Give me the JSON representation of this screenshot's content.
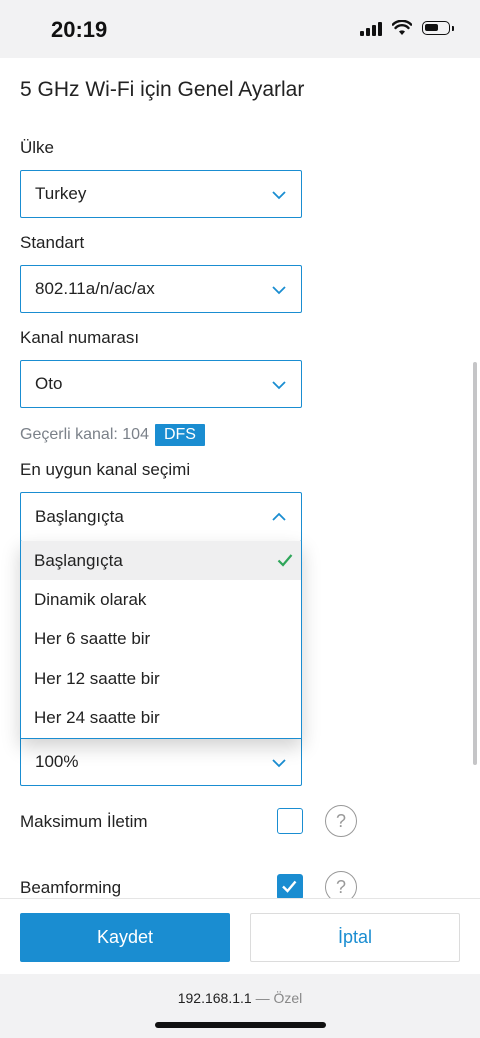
{
  "status_bar": {
    "time": "20:19"
  },
  "page": {
    "title": "5 GHz Wi-Fi için Genel Ayarlar"
  },
  "fields": {
    "country": {
      "label": "Ülke",
      "value": "Turkey"
    },
    "standard": {
      "label": "Standart",
      "value": "802.11a/n/ac/ax"
    },
    "channel": {
      "label": "Kanal numarası",
      "value": "Oto"
    },
    "current_channel": {
      "text": "Geçerli kanal: 104",
      "badge": "DFS"
    },
    "optimal_channel": {
      "label": "En uygun kanal seçimi",
      "value": "Başlangıçta",
      "options": [
        "Başlangıçta",
        "Dinamik olarak",
        "Her 6 saatte bir",
        "Her 12 saatte bir",
        "Her 24 saatte bir"
      ],
      "selected_index": 0
    },
    "power": {
      "value": "100%"
    }
  },
  "toggles": {
    "max_transmit": {
      "label": "Maksimum İletim",
      "checked": false,
      "help": "?"
    },
    "beamforming": {
      "label": "Beamforming",
      "checked": true,
      "help": "?"
    }
  },
  "actions": {
    "save": "Kaydet",
    "cancel": "İptal"
  },
  "browser": {
    "url": "192.168.1.1",
    "separator": "—",
    "mode": "Özel"
  },
  "colors": {
    "accent": "#1a8dd1",
    "status_bg": "#f2f2f3"
  }
}
